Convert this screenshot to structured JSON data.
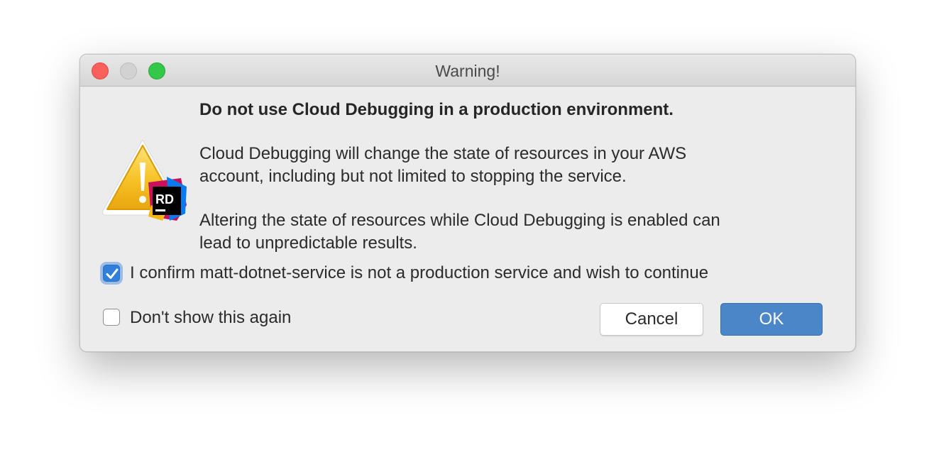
{
  "window": {
    "title": "Warning!"
  },
  "message": {
    "heading": "Do not use Cloud Debugging in a production environment.",
    "paragraph1_line1": "Cloud Debugging will change the state of resources in your AWS",
    "paragraph1_line2": "account, including but not limited to stopping the service.",
    "paragraph2_line1": "Altering the state of resources while Cloud Debugging is enabled can",
    "paragraph2_line2": "lead to unpredictable results."
  },
  "icon": {
    "name": "warning-rider-icon",
    "badge_text": "RD",
    "colors": {
      "triangle": "#f2b51a",
      "badge_bg": "#000000",
      "badge_accent1": "#c90f5e",
      "badge_accent2": "#077cf0",
      "badge_accent3": "#fdb60d"
    }
  },
  "confirm": {
    "label": "I confirm matt-dotnet-service is not a production service and wish to continue",
    "checked": true
  },
  "dont_show": {
    "label": "Don't show this again",
    "checked": false
  },
  "buttons": {
    "cancel": "Cancel",
    "ok": "OK"
  },
  "colors": {
    "accent": "#4a86c8",
    "traffic_close": "#fc605c",
    "traffic_max": "#34c84a"
  }
}
